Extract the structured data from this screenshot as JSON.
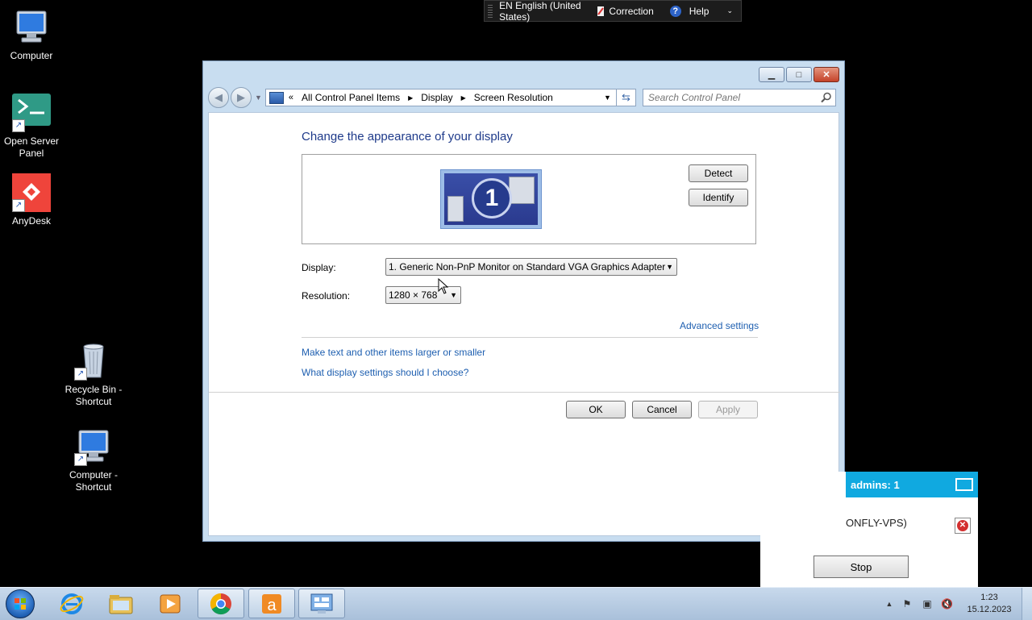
{
  "desktop": {
    "icons": [
      {
        "label": "Computer",
        "icon": "computer-icon"
      },
      {
        "label": "Open Server Panel",
        "icon": "terminal-icon"
      },
      {
        "label": "AnyDesk",
        "icon": "anydesk-icon"
      },
      {
        "label": "Recycle Bin - Shortcut",
        "icon": "recycle-bin-icon"
      },
      {
        "label": "Computer - Shortcut",
        "icon": "computer-icon"
      }
    ]
  },
  "language_bar": {
    "language": "EN English (United States)",
    "correction": "Correction",
    "help": "Help"
  },
  "window": {
    "breadcrumbs": [
      "All Control Panel Items",
      "Display",
      "Screen Resolution"
    ],
    "search_placeholder": "Search Control Panel",
    "heading": "Change the appearance of your display",
    "monitor_number": "1",
    "detect_label": "Detect",
    "identify_label": "Identify",
    "display_label": "Display:",
    "display_value": "1. Generic Non-PnP Monitor on Standard VGA Graphics Adapter",
    "resolution_label": "Resolution:",
    "resolution_value": "1280 × 768",
    "advanced_link": "Advanced settings",
    "text_size_link": "Make text and other items larger or smaller",
    "help_link": "What display settings should I choose?",
    "ok_label": "OK",
    "cancel_label": "Cancel",
    "apply_label": "Apply"
  },
  "anydesk_panel": {
    "header": "admins: 1",
    "session_name": "ONFLY-VPS)",
    "stop_label": "Stop"
  },
  "taskbar": {
    "pinned": [
      "internet-explorer-icon",
      "file-explorer-icon",
      "media-player-icon",
      "chrome-icon",
      "anydesk-taskbar-icon",
      "control-panel-icon"
    ],
    "time": "1:23",
    "date": "15.12.2023"
  },
  "colors": {
    "heading": "#1e3a8a",
    "link": "#1e5fb0",
    "anydesk_accent": "#10a9e0",
    "anydesk_red": "#ef443b"
  }
}
